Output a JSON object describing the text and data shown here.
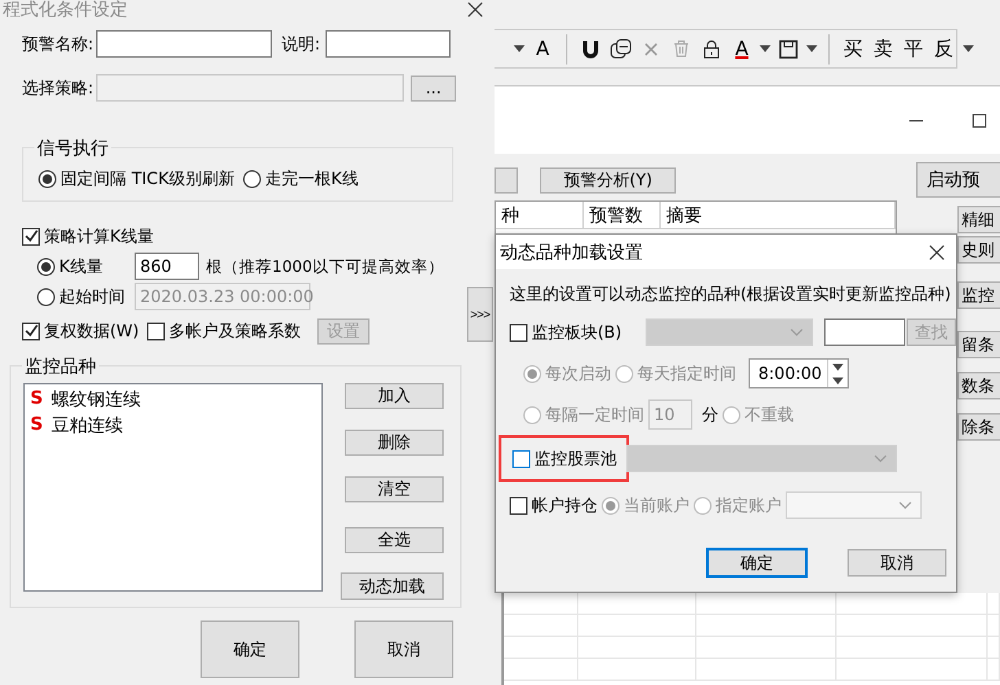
{
  "main_window": {
    "toolbar": [
      {
        "kind": "caret"
      },
      {
        "kind": "text",
        "text": "A"
      },
      {
        "kind": "sep"
      },
      {
        "kind": "magnet"
      },
      {
        "kind": "copy"
      },
      {
        "kind": "delete"
      },
      {
        "kind": "trash"
      },
      {
        "kind": "lock"
      },
      {
        "kind": "font-color",
        "text": "A"
      },
      {
        "kind": "caret"
      },
      {
        "kind": "save"
      },
      {
        "kind": "caret"
      },
      {
        "kind": "sep"
      },
      {
        "kind": "text",
        "text": "买"
      },
      {
        "kind": "text",
        "text": "卖"
      },
      {
        "kind": "text",
        "text": "平"
      },
      {
        "kind": "text",
        "text": "反"
      },
      {
        "kind": "more"
      }
    ],
    "analysis_button": "预警分析(Y)",
    "start_button": "启动预",
    "table": {
      "columns": [
        "种",
        "预警数",
        "摘要"
      ]
    },
    "side_buttons": [
      "精细",
      "史则",
      "监控",
      "留条",
      "数条",
      "除条"
    ]
  },
  "settings_dialog": {
    "title": "程式化条件设定",
    "alert_name_label": "预警名称:",
    "description_label": "说明:",
    "strategy_label": "选择策略:",
    "browse_button": "...",
    "signal_group": {
      "title": "信号执行",
      "options": [
        {
          "label": "固定间隔 TICK级别刷新",
          "selected": true
        },
        {
          "label": "走完一根K线",
          "selected": false
        }
      ]
    },
    "kline_calc": {
      "label": "策略计算K线量",
      "checked": true
    },
    "kline_options": [
      {
        "label": "K线量",
        "selected": true,
        "value": "860",
        "note": "根（推荐1000以下可提高效率）"
      },
      {
        "label": "起始时间",
        "selected": false,
        "value": "2020.03.23 00:00:00"
      }
    ],
    "adjusted_data": {
      "label": "复权数据(W)",
      "checked": true
    },
    "multi_account": {
      "label": "多帐户及策略系数",
      "checked": false
    },
    "setup_button": "设置",
    "watch_group": {
      "title": "监控品种",
      "items": [
        {
          "mark": "S",
          "name": "螺纹钢连续"
        },
        {
          "mark": "S",
          "name": "豆粕连续"
        }
      ],
      "buttons": [
        "加入",
        "删除",
        "清空",
        "全选",
        "动态加载"
      ]
    },
    "expand_button": ">>>",
    "ok": "确定",
    "cancel": "取消"
  },
  "dynamic_dialog": {
    "title": "动态品种加载设置",
    "description": "这里的设置可以动态监控的品种(根据设置实时更新监控品种)",
    "sector": {
      "label": "监控板块(B)",
      "checked": false,
      "find_button": "查找"
    },
    "reload_options": [
      {
        "kind": "startup",
        "label": "每次启动",
        "selected": true
      },
      {
        "kind": "daily",
        "label": "每天指定时间",
        "selected": false,
        "time": "8:00:00"
      },
      {
        "kind": "interval",
        "label": "每隔一定时间",
        "selected": false,
        "value": "10",
        "unit": "分"
      },
      {
        "kind": "none",
        "label": "不重载",
        "selected": false
      }
    ],
    "stock_pool": {
      "label": "监控股票池",
      "checked": false,
      "highlighted": true
    },
    "positions": {
      "label": "帐户持仓",
      "checked": false,
      "options": [
        {
          "label": "当前账户",
          "selected": true
        },
        {
          "label": "指定账户",
          "selected": false
        }
      ]
    },
    "ok": "确定",
    "cancel": "取消"
  }
}
